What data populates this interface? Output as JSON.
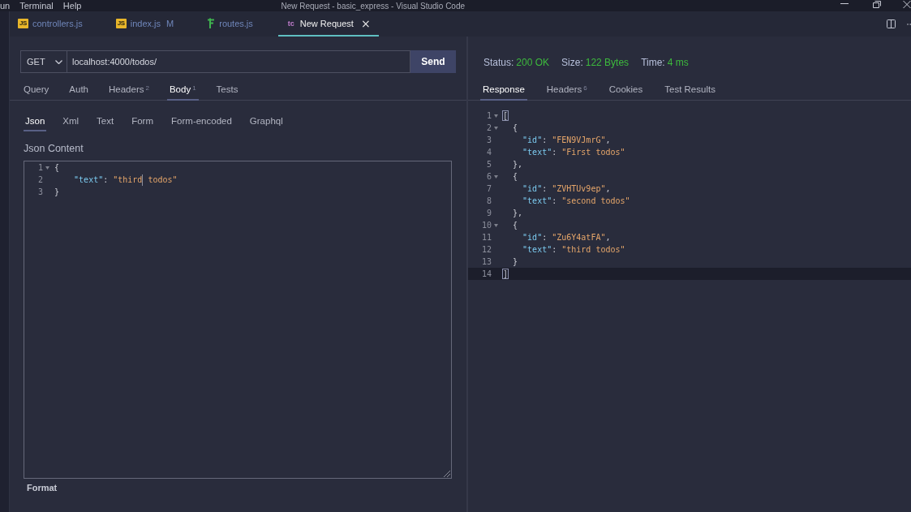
{
  "window": {
    "menu": [
      "un",
      "Terminal",
      "Help"
    ],
    "title": "New Request - basic_express - Visual Studio Code"
  },
  "editor_tabs": [
    {
      "kind": "js",
      "icon_text": "JS",
      "label": "controllers.js",
      "selected": false
    },
    {
      "kind": "js",
      "icon_text": "JS",
      "label": "index.js",
      "badge": "M",
      "selected": false
    },
    {
      "kind": "route",
      "label": "routes.js",
      "selected": false
    },
    {
      "kind": "request",
      "icon_text": "tc",
      "label": "New Request",
      "close": "×",
      "selected": true
    }
  ],
  "request": {
    "method": "GET",
    "url": "localhost:4000/todos/",
    "send": "Send"
  },
  "request_tabs": [
    {
      "label": "Query",
      "selected": false
    },
    {
      "label": "Auth",
      "selected": false
    },
    {
      "label": "Headers",
      "count": "2",
      "selected": false
    },
    {
      "label": "Body",
      "count": "1",
      "selected": true
    },
    {
      "label": "Tests",
      "selected": false
    }
  ],
  "body_types": [
    {
      "label": "Json",
      "selected": true
    },
    {
      "label": "Xml",
      "selected": false
    },
    {
      "label": "Text",
      "selected": false
    },
    {
      "label": "Form",
      "selected": false
    },
    {
      "label": "Form-encoded",
      "selected": false
    },
    {
      "label": "Graphql",
      "selected": false
    }
  ],
  "body_editor": {
    "label": "Json Content",
    "lines": [
      {
        "number": "1",
        "foldable": true,
        "tokens": [
          {
            "kind": "punct",
            "text": "{"
          }
        ]
      },
      {
        "number": "2",
        "foldable": false,
        "tokens": [
          {
            "kind": "key",
            "text": "    \"text\""
          },
          {
            "kind": "punct",
            "text": ": "
          },
          {
            "kind": "string",
            "text": "\"third"
          },
          {
            "kind": "cursor"
          },
          {
            "kind": "string",
            "text": " todos\""
          }
        ]
      },
      {
        "number": "3",
        "foldable": false,
        "tokens": [
          {
            "kind": "punct",
            "text": "}"
          }
        ]
      }
    ]
  },
  "format_button": "Format",
  "response": {
    "meta": [
      {
        "label": "Status:",
        "value": "200 OK"
      },
      {
        "label": "Size:",
        "value": "122 Bytes"
      },
      {
        "label": "Time:",
        "value": "4 ms"
      }
    ],
    "tabs": [
      {
        "label": "Response",
        "selected": true
      },
      {
        "label": "Headers",
        "count": "6",
        "selected": false
      },
      {
        "label": "Cookies",
        "selected": false
      },
      {
        "label": "Test Results",
        "selected": false
      }
    ],
    "lines": [
      {
        "number": "1",
        "foldable": true,
        "current": false,
        "tokens": [
          {
            "kind": "bracket",
            "text": "["
          }
        ]
      },
      {
        "number": "2",
        "foldable": true,
        "current": false,
        "tokens": [
          {
            "kind": "punct",
            "text": "  {"
          }
        ]
      },
      {
        "number": "3",
        "foldable": false,
        "current": false,
        "tokens": [
          {
            "kind": "key",
            "text": "    \"id\""
          },
          {
            "kind": "punct",
            "text": ": "
          },
          {
            "kind": "string",
            "text": "\"FEN9VJmrG\""
          },
          {
            "kind": "punct",
            "text": ","
          }
        ]
      },
      {
        "number": "4",
        "foldable": false,
        "current": false,
        "tokens": [
          {
            "kind": "key",
            "text": "    \"text\""
          },
          {
            "kind": "punct",
            "text": ": "
          },
          {
            "kind": "string",
            "text": "\"First todos\""
          }
        ]
      },
      {
        "number": "5",
        "foldable": false,
        "current": false,
        "tokens": [
          {
            "kind": "punct",
            "text": "  },"
          }
        ]
      },
      {
        "number": "6",
        "foldable": true,
        "current": false,
        "tokens": [
          {
            "kind": "punct",
            "text": "  {"
          }
        ]
      },
      {
        "number": "7",
        "foldable": false,
        "current": false,
        "tokens": [
          {
            "kind": "key",
            "text": "    \"id\""
          },
          {
            "kind": "punct",
            "text": ": "
          },
          {
            "kind": "string",
            "text": "\"ZVHTUv9ep\""
          },
          {
            "kind": "punct",
            "text": ","
          }
        ]
      },
      {
        "number": "8",
        "foldable": false,
        "current": false,
        "tokens": [
          {
            "kind": "key",
            "text": "    \"text\""
          },
          {
            "kind": "punct",
            "text": ": "
          },
          {
            "kind": "string",
            "text": "\"second todos\""
          }
        ]
      },
      {
        "number": "9",
        "foldable": false,
        "current": false,
        "tokens": [
          {
            "kind": "punct",
            "text": "  },"
          }
        ]
      },
      {
        "number": "10",
        "foldable": true,
        "current": false,
        "tokens": [
          {
            "kind": "punct",
            "text": "  {"
          }
        ]
      },
      {
        "number": "11",
        "foldable": false,
        "current": false,
        "tokens": [
          {
            "kind": "key",
            "text": "    \"id\""
          },
          {
            "kind": "punct",
            "text": ": "
          },
          {
            "kind": "string",
            "text": "\"Zu6Y4atFA\""
          },
          {
            "kind": "punct",
            "text": ","
          }
        ]
      },
      {
        "number": "12",
        "foldable": false,
        "current": false,
        "tokens": [
          {
            "kind": "key",
            "text": "    \"text\""
          },
          {
            "kind": "punct",
            "text": ": "
          },
          {
            "kind": "string",
            "text": "\"third todos\""
          }
        ]
      },
      {
        "number": "13",
        "foldable": false,
        "current": false,
        "tokens": [
          {
            "kind": "punct",
            "text": "  }"
          }
        ]
      },
      {
        "number": "14",
        "foldable": false,
        "current": true,
        "tokens": [
          {
            "kind": "bracket",
            "text": "]"
          }
        ]
      }
    ]
  }
}
